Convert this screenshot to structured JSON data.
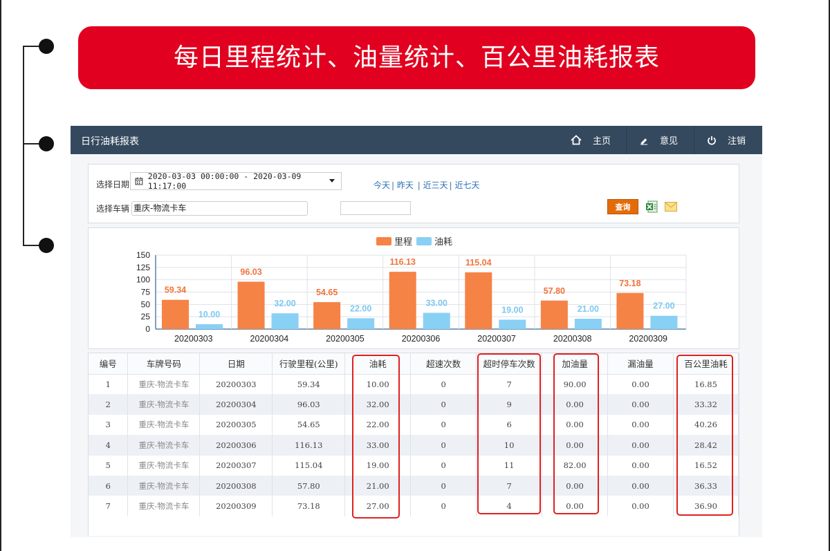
{
  "banner": {
    "title": "每日里程统计、油量统计、百公里油耗报表"
  },
  "app": {
    "title": "日行油耗报表",
    "nav": [
      {
        "label": "主页",
        "icon": "home-icon"
      },
      {
        "label": "意见",
        "icon": "pencil-icon"
      },
      {
        "label": "注销",
        "icon": "power-icon"
      }
    ]
  },
  "filter": {
    "date_label": "选择日期",
    "date_range": "2020-03-03 00:00:00 - 2020-03-09 11:17:00",
    "quick_today": "今天",
    "quick_yesterday": "昨天",
    "quick_3days": "近三天",
    "quick_7days": "近七天",
    "vehicle_label": "选择车辆",
    "vehicle_value": "重庆-物流卡车",
    "query_button": "查询"
  },
  "chart_data": {
    "type": "bar",
    "categories": [
      "20200303",
      "20200304",
      "20200305",
      "20200306",
      "20200307",
      "20200308",
      "20200309"
    ],
    "series": [
      {
        "name": "里程",
        "color": "#f58345",
        "values": [
          59.34,
          96.03,
          54.65,
          116.13,
          115.04,
          57.8,
          73.18
        ],
        "labels": [
          "59.34",
          "96.03",
          "54.65",
          "116.13",
          "115.04",
          "57.80",
          "73.18"
        ]
      },
      {
        "name": "油耗",
        "color": "#89d0f5",
        "values": [
          10.0,
          32.0,
          22.0,
          33.0,
          19.0,
          21.0,
          27.0
        ],
        "labels": [
          "10.00",
          "32.00",
          "22.00",
          "33.00",
          "19.00",
          "21.00",
          "27.00"
        ]
      }
    ],
    "ylim": [
      0,
      150
    ],
    "yticks": [
      "0",
      "25",
      "50",
      "75",
      "100",
      "125",
      "150"
    ],
    "legend": "top-center",
    "grid": true
  },
  "table": {
    "headers": [
      "编号",
      "车牌号码",
      "日期",
      "行驶里程(公里)",
      "油耗",
      "超速次数",
      "超时停车次数",
      "加油量",
      "漏油量",
      "百公里油耗"
    ],
    "rows": [
      [
        "1",
        "重庆-物流卡车",
        "20200303",
        "59.34",
        "10.00",
        "0",
        "7",
        "90.00",
        "0.00",
        "16.85"
      ],
      [
        "2",
        "重庆-物流卡车",
        "20200304",
        "96.03",
        "32.00",
        "0",
        "9",
        "0.00",
        "0.00",
        "33.32"
      ],
      [
        "3",
        "重庆-物流卡车",
        "20200305",
        "54.65",
        "22.00",
        "0",
        "6",
        "0.00",
        "0.00",
        "40.26"
      ],
      [
        "4",
        "重庆-物流卡车",
        "20200306",
        "116.13",
        "33.00",
        "0",
        "10",
        "0.00",
        "0.00",
        "28.42"
      ],
      [
        "5",
        "重庆-物流卡车",
        "20200307",
        "115.04",
        "19.00",
        "0",
        "11",
        "82.00",
        "0.00",
        "16.52"
      ],
      [
        "6",
        "重庆-物流卡车",
        "20200308",
        "57.80",
        "21.00",
        "0",
        "7",
        "0.00",
        "0.00",
        "36.33"
      ],
      [
        "7",
        "重庆-物流卡车",
        "20200309",
        "73.18",
        "27.00",
        "0",
        "4",
        "0.00",
        "0.00",
        "36.90"
      ]
    ]
  }
}
